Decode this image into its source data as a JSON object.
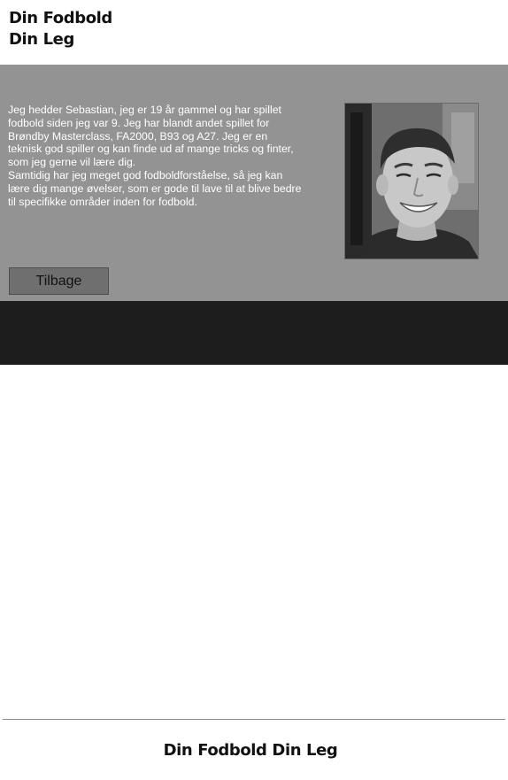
{
  "header": {
    "logo_line_1": "Din Fodbold",
    "logo_line_2": "Din Leg"
  },
  "profile": {
    "bio_lines": [
      "Jeg hedder Sebastian, jeg er 19 år gammel og har spillet",
      "fodbold siden jeg var 9. Jeg har blandt andet spillet for",
      "Brøndby Masterclass, FA2000, B93 og A27. Jeg er en",
      "teknisk god spiller og kan finde ud af mange tricks og finter,",
      "som jeg gerne vil lære dig.",
      "Samtidig har jeg meget god fodboldforståelse, så jeg kan",
      "lære dig mange øvelser, som er gode til lave til at blive bedre",
      "til specifikke områder inden for fodbold."
    ],
    "back_button_label": "Tilbage"
  },
  "footer": {
    "text": "Din Fodbold Din Leg"
  }
}
